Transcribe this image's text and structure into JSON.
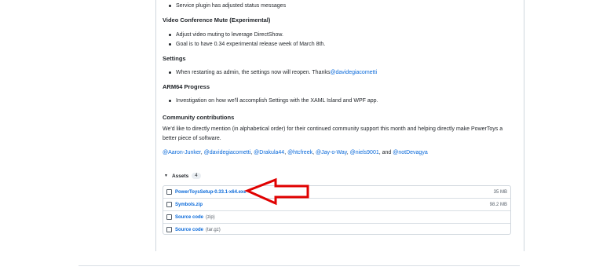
{
  "top_bullet": "Service plugin has adjusted status messages",
  "video": {
    "heading": "Video Conference Mute (Experimental)",
    "items": [
      "Adjust video muting to leverage DirectShow.",
      "Goal is to have 0.34 experimental release week of March 8th."
    ]
  },
  "settings": {
    "heading": "Settings",
    "item_prefix": "When restarting as admin, the settings now will reopen. Thanks ",
    "item_link": "@davidegiacometti"
  },
  "arm64": {
    "heading": "ARM64 Progress",
    "item": "Investigation on how we'll accomplish Settings with the XAML Island and WPF app."
  },
  "community": {
    "heading": "Community contributions",
    "paragraph": "We'd like to directly mention (in alphabetical order) for their continued community support this month and helping directly make PowerToys a better piece of software.",
    "contributors": [
      "@Aaron-Junker",
      "@davidegiacometti",
      "@Drakula44",
      "@htcfreek",
      "@Jay-o-Way",
      "@niels9001",
      "@notDevagya"
    ],
    "sep": ", ",
    "last_sep": ", and "
  },
  "assets": {
    "label": "Assets",
    "count": "4",
    "files": [
      {
        "name": "PowerToysSetup-0.33.1-x64.exe",
        "size": "35 MB",
        "icon": "package-icon"
      },
      {
        "name": "Symbols.zip",
        "size": "98.2 MB",
        "icon": "package-icon"
      },
      {
        "name": "Source code",
        "suffix": "(zip)",
        "size": "",
        "icon": "file-zip-icon"
      },
      {
        "name": "Source code",
        "suffix": "(tar.gz)",
        "size": "",
        "icon": "file-zip-icon"
      }
    ]
  },
  "colors": {
    "link": "#0969da",
    "arrow": "#e00000"
  }
}
